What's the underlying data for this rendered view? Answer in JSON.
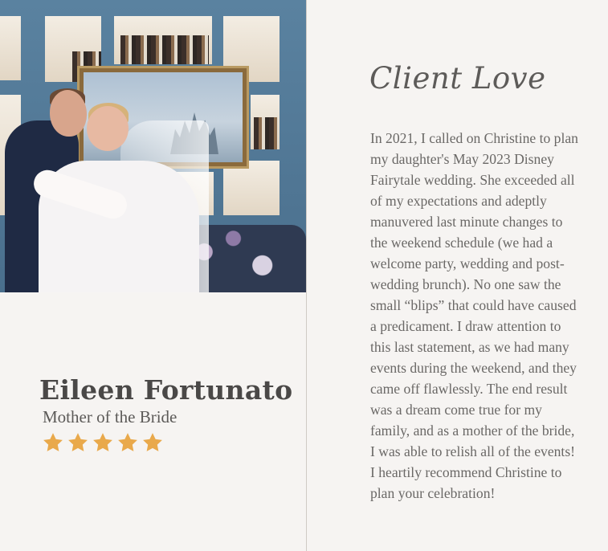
{
  "photo": {
    "alt": "Bride and groom embracing in front of a blue bookcase with a castle painting"
  },
  "client": {
    "name": "Eileen Fortunato",
    "role": "Mother of the Bride",
    "rating": 5,
    "rating_max": 5,
    "star_color": "#e9a94b"
  },
  "section": {
    "heading": "Client Love"
  },
  "testimonial": {
    "text": "In 2021, I called on Christine to plan my daughter's May 2023 Disney Fairytale wedding. She exceeded all of my expectations and adeptly manuvered last minute changes to the weekend schedule (we had a welcome party, wedding and post-wedding brunch). No one saw the small “blips” that could have caused a predicament. I draw attention to this last statement, as we had many events during the weekend, and they came off flawlessly. The end result was a dream come true for my family, and as a mother of the bride, I was able to relish all of the events! I heartily recommend Christine to plan your celebration!"
  }
}
